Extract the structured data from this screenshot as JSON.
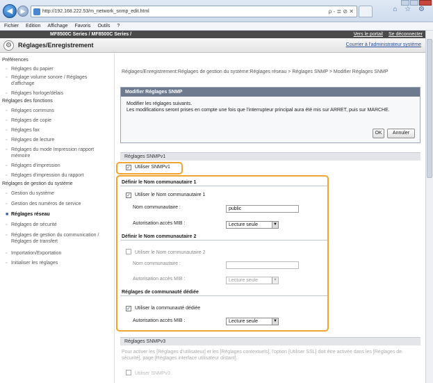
{
  "browser": {
    "url": "http://192.168.222.53/m_network_snmp_edit.html",
    "address_tools": "ρ - ≣ ⊘ ✕",
    "right_icons": "⌂ ☆ ⚙"
  },
  "menu": [
    "Fichier",
    "Edition",
    "Affichage",
    "Favoris",
    "Outils",
    "?"
  ],
  "header": {
    "product": "MF8500C Series / MF8500C Series /",
    "portal_link": "Vers le portail",
    "logout_link": "Se déconnecter",
    "app_title": "Réglages/Enregistrement",
    "admin_link": "Courrier à l'administrateur système"
  },
  "sidebar": {
    "sections": [
      {
        "label": "Préférences",
        "items": [
          "Réglages du papier",
          "Réglage volume sonore / Réglages d'affichage",
          "Réglages horloge/délais"
        ]
      },
      {
        "label": "Réglages des fonctions",
        "items": [
          "Réglages communs",
          "Réglages de copie",
          "Réglages fax",
          "Réglages de lecture",
          "Réglages du mode Impression rapport mémoire",
          "Réglages d'impression",
          "Réglages d'impression du rapport"
        ]
      },
      {
        "label": "Réglages de gestion du système",
        "items": [
          "Gestion du système",
          "Gestion des numéros de service",
          "Réglages réseau",
          "Réglages de sécurité",
          "Réglages de gestion du communication / Réglages de transfert",
          "Importation/Exportation",
          "Initialiser les réglages"
        ]
      }
    ]
  },
  "main": {
    "breadcrumb": "Réglages/Enregistrement:Réglages de gestion du système:Réglages réseau > Réglages SNMP > Modifier Réglages SNMP",
    "box_title": "Modifier Réglages SNMP",
    "message": "Modifier les réglages suivants.\nLes modifications seront prises en compte une fois que l'interrupteur principal aura été mis sur ARRET, puis sur MARCHE.",
    "ok_label": "OK",
    "cancel_label": "Annuler",
    "snmpv1_header": "Réglages SNMPv1",
    "use_snmpv1": "Utiliser SNMPv1",
    "community1_header": "Définir le Nom communautaire 1",
    "use_community1": "Utiliser le Nom communautaire 1",
    "community_name_label": "Nom communautaire :",
    "community1_value": "public",
    "mib_label": "Autorisation accès MIB :",
    "mib1_value": "Lecture seule",
    "community2_header": "Définir le Nom communautaire 2",
    "use_community2": "Utiliser le Nom communautaire 2",
    "community2_value": "",
    "mib2_value": "Lecture seule",
    "dedicated_header": "Réglages de communauté dédiée",
    "use_dedicated": "Utiliser la communauté dédiée",
    "mib3_value": "Lecture seule",
    "snmpv3_header": "Réglages SNMPv3",
    "snmpv3_note": "Pour activer les [Réglages d'utilisateur] et les [Réglages contextuels], l'option [Utiliser SSL] doit être activée dans les [Réglages de sécurité], page [Réglages interface utilisateur distant].",
    "use_snmpv3": "Utiliser SNMPv3"
  },
  "colors": {
    "highlight": "#f0a530",
    "link": "#2a4fa0",
    "box_header": "#6e7b8e"
  }
}
